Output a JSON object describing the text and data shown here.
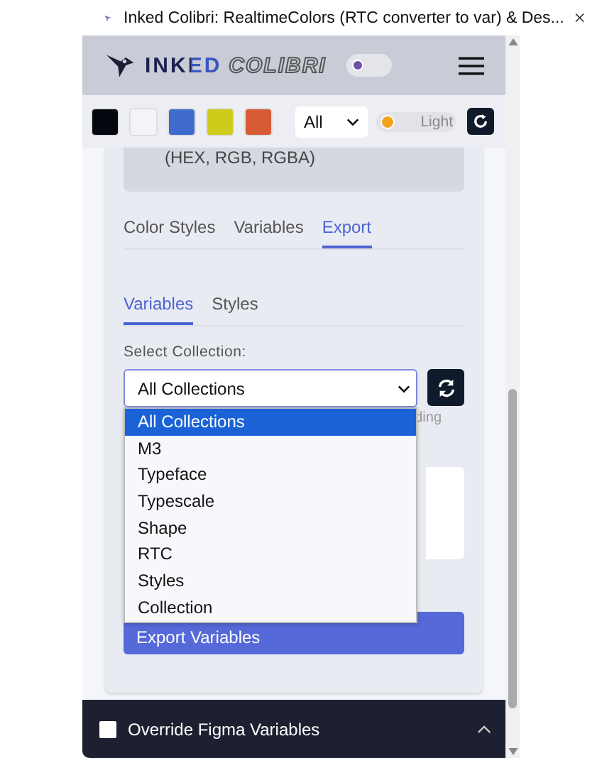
{
  "tab_title": "Inked Colibri: RealtimeColors (RTC converter to var) & Des...",
  "header": {
    "logo_bold": "INKED",
    "logo_outline": "COLIBRI",
    "theme_toggle_on": false
  },
  "toolbar": {
    "swatches": [
      {
        "color": "#05070f"
      },
      {
        "color": "#f3f4f9"
      },
      {
        "color": "#3f6bcc"
      },
      {
        "color": "#cdcc1a"
      },
      {
        "color": "#d65a33"
      }
    ],
    "filter": "All",
    "mode_label": "Light",
    "mode_on": false
  },
  "format_note": "(HEX, RGB, RGBA)",
  "tabs": [
    {
      "label": "Color Styles",
      "selected": false
    },
    {
      "label": "Variables",
      "selected": false
    },
    {
      "label": "Export",
      "selected": true
    }
  ],
  "subtabs": [
    {
      "label": "Variables",
      "selected": true
    },
    {
      "label": "Styles",
      "selected": false
    }
  ],
  "collection_label": "Select Collection:",
  "collection_value": "All Collections",
  "options": [
    {
      "label": "All Collections",
      "selected": true
    },
    {
      "label": "M3",
      "selected": false
    },
    {
      "label": "Typeface",
      "selected": false
    },
    {
      "label": "Typescale",
      "selected": false
    },
    {
      "label": "Shape",
      "selected": false
    },
    {
      "label": "RTC",
      "selected": false
    },
    {
      "label": "Styles",
      "selected": false
    },
    {
      "label": "Collection",
      "selected": false
    }
  ],
  "hidden_hint": "ding",
  "export_button": "Export Variables",
  "override": {
    "label": "Override Figma Variables",
    "checked": false
  }
}
